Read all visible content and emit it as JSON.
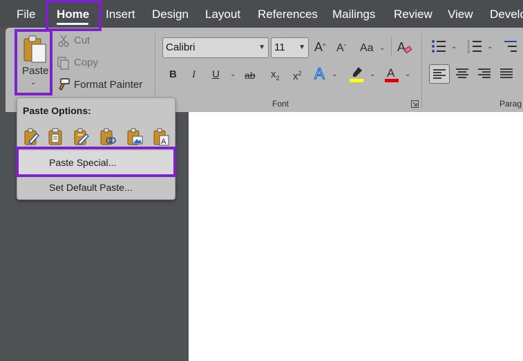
{
  "tabs": [
    {
      "id": "file",
      "label": "File"
    },
    {
      "id": "home",
      "label": "Home"
    },
    {
      "id": "insert",
      "label": "Insert"
    },
    {
      "id": "design",
      "label": "Design"
    },
    {
      "id": "layout",
      "label": "Layout"
    },
    {
      "id": "references",
      "label": "References"
    },
    {
      "id": "mailings",
      "label": "Mailings"
    },
    {
      "id": "review",
      "label": "Review"
    },
    {
      "id": "view",
      "label": "View"
    },
    {
      "id": "developer",
      "label": "Develo"
    }
  ],
  "clipboard": {
    "paste_label": "Paste",
    "cut_label": "Cut",
    "copy_label": "Copy",
    "format_painter_label": "Format Painter"
  },
  "font": {
    "group_label": "Font",
    "font_name": "Calibri",
    "font_size": "11",
    "case_label": "Aa"
  },
  "paragraph": {
    "group_label": "Parag"
  },
  "paste_menu": {
    "header": "Paste Options:",
    "paste_special": "Paste Special...",
    "set_default": "Set Default Paste..."
  },
  "colors": {
    "highlight_box": "#7b22c8",
    "highlight_yellow": "#ffff00",
    "font_red": "#e00000",
    "text_effects_blue": "#1f6fd1"
  }
}
